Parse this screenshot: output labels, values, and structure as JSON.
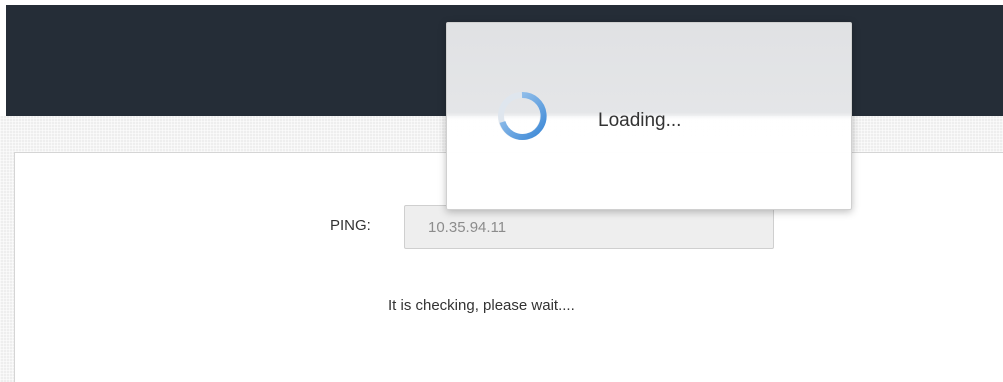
{
  "dialog": {
    "loading_text": "Loading...",
    "spinner_icon": "loading-spinner-icon"
  },
  "form": {
    "ping_label": "PING:",
    "ping_value": "10.35.94.11"
  },
  "status": {
    "message": "It is checking, please wait...."
  },
  "colors": {
    "header": "#252d37",
    "spinner": "#4a90d9",
    "input_bg": "#eeeeee"
  }
}
